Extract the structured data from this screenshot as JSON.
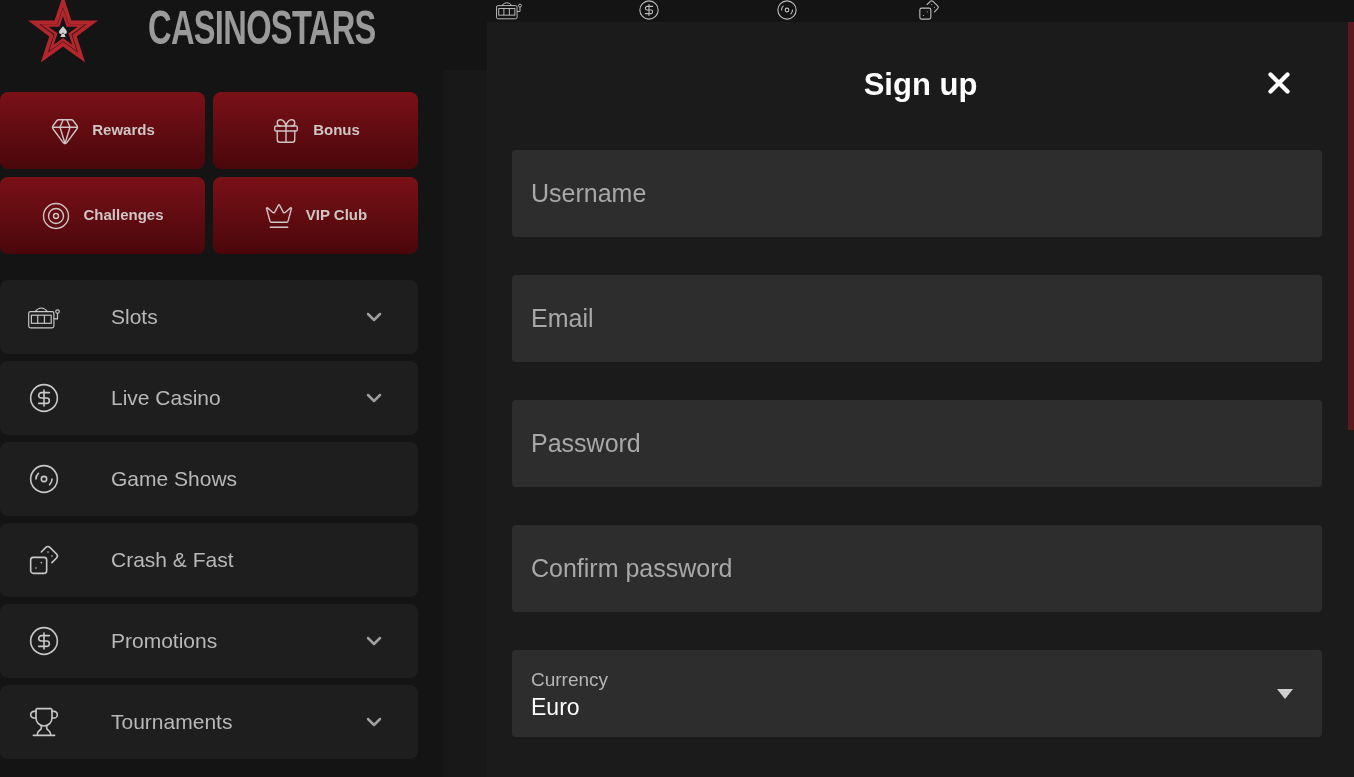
{
  "brand": {
    "name": "CASINOSTARS"
  },
  "quick_links": [
    {
      "label": "Rewards"
    },
    {
      "label": "Bonus"
    },
    {
      "label": "Challenges"
    },
    {
      "label": "VIP Club"
    }
  ],
  "menu": [
    {
      "label": "Slots",
      "expandable": true
    },
    {
      "label": "Live Casino",
      "expandable": true
    },
    {
      "label": "Game Shows",
      "expandable": false
    },
    {
      "label": "Crash & Fast",
      "expandable": false
    },
    {
      "label": "Promotions",
      "expandable": true
    },
    {
      "label": "Tournaments",
      "expandable": true
    }
  ],
  "dialog": {
    "title": "Sign up",
    "fields": [
      {
        "kind": "text",
        "placeholder": "Username"
      },
      {
        "kind": "text",
        "placeholder": "Email"
      },
      {
        "kind": "text",
        "placeholder": "Password"
      },
      {
        "kind": "text",
        "placeholder": "Confirm password"
      },
      {
        "kind": "select",
        "label": "Currency",
        "value": "Euro"
      }
    ]
  }
}
